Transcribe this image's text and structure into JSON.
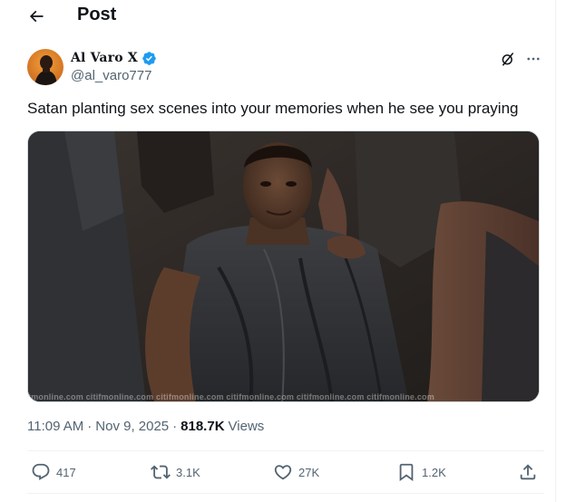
{
  "header": {
    "title": "Post"
  },
  "author": {
    "display_name": "Al Varo X",
    "handle": "@al_varo777",
    "verified": true
  },
  "tweet": {
    "text": "Satan planting sex scenes into your memories when he see you praying",
    "watermark": "tmonline.com citifmonline.com citifmonline.com citifmonline.com citifmonline.com citifmonline.com"
  },
  "meta": {
    "time": "11:09 AM",
    "date": "Nov 9, 2025",
    "separator": "·",
    "views_count": "818.7K",
    "views_label": "Views"
  },
  "actions": {
    "replies": "417",
    "reposts": "3.1K",
    "likes": "27K",
    "bookmarks": "1.2K"
  },
  "colors": {
    "text_primary": "#0f1419",
    "text_secondary": "#536471",
    "verified_blue": "#1d9bf0",
    "divider": "#eff3f4"
  },
  "icons": {
    "back": "arrow-left-icon",
    "verified": "verified-badge-icon",
    "grok": "grok-icon",
    "more": "more-horizontal-icon",
    "reply": "reply-icon",
    "repost": "repost-icon",
    "like": "heart-icon",
    "bookmark": "bookmark-icon",
    "share": "share-icon"
  }
}
